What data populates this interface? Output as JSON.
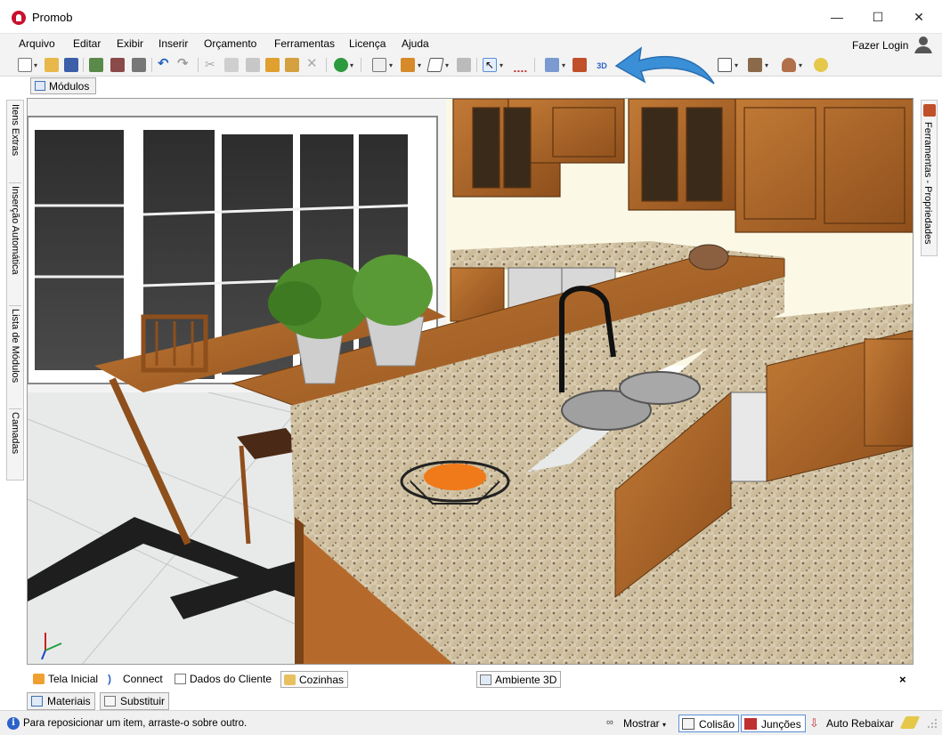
{
  "window": {
    "title": "Promob",
    "min_glyph": "—",
    "max_glyph": "☐",
    "close_glyph": "✕"
  },
  "menu": {
    "items": [
      "Arquivo",
      "Editar",
      "Exibir",
      "Inserir",
      "Orçamento",
      "Ferramentas",
      "Licença",
      "Ajuda"
    ],
    "login_label": "Fazer Login"
  },
  "toolbar": {
    "icons": [
      "new-icon",
      "open-icon",
      "save-icon",
      "print-preview-icon",
      "print-icon",
      "print-setup-icon",
      "undo-icon",
      "redo-icon",
      "cut-icon",
      "copy-icon",
      "paste-icon",
      "paint-icon",
      "brush-icon",
      "delete-icon",
      "budget-icon",
      "modules-icon",
      "assembly-icon",
      "shape-icon",
      "panel-icon",
      "select-icon",
      "measure-icon",
      "layers-icon",
      "dimension-icon",
      "view-3d-icon",
      "camera-icon",
      "box-icon",
      "lamp-icon",
      "light-icon"
    ],
    "view_3d_label": "3D"
  },
  "panels": {
    "modules_tab": "Módulos",
    "left_tabs": [
      "Itens Extras",
      "Inserção Automática",
      "Lista de Módulos",
      "Camadas"
    ],
    "right_tab": "Ferramentas - Propriedades"
  },
  "bottom_tabs": {
    "items": [
      "Tela Inicial",
      "Connect",
      "Dados do Cliente",
      "Cozinhas"
    ],
    "active": "Cozinhas",
    "view_tab": "Ambiente 3D",
    "close_glyph": "×"
  },
  "lower_tabs": [
    "Materiais",
    "Substituir"
  ],
  "status": {
    "message": "Para reposicionar um item, arraste-o sobre outro.",
    "show_label": "Mostrar",
    "collision_label": "Colisão",
    "joints_label": "Junções",
    "auto_lower_label": "Auto Rebaixar"
  },
  "colors": {
    "accent": "#2a62c9",
    "wood": "#b36a2a",
    "granite": "#d8cbb0",
    "floor_dark": "#1e1e1e",
    "annotation_arrow": "#3a8fd6"
  }
}
